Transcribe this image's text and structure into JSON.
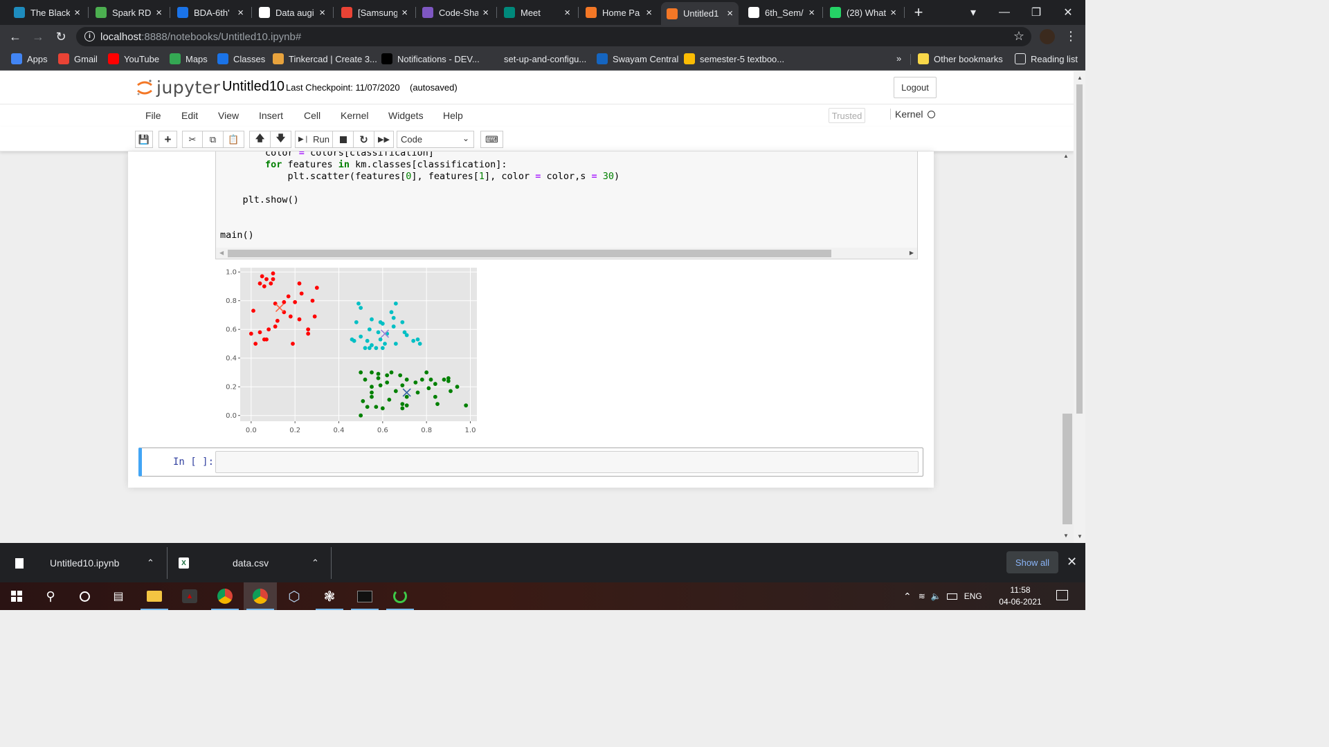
{
  "browser": {
    "tabs": [
      {
        "title": "The Black",
        "icon": "wordpress-icon",
        "color": "#1e8cbe"
      },
      {
        "title": "Spark RDI",
        "icon": "chart-icon",
        "color": "#4caf50"
      },
      {
        "title": "BDA-6th'",
        "icon": "classroom-icon",
        "color": "#1a73e8"
      },
      {
        "title": "Data augi",
        "icon": "github-icon",
        "color": "#ffffff"
      },
      {
        "title": "[Samsung",
        "icon": "gmail-icon",
        "color": "#ea4335"
      },
      {
        "title": "Code-Sha",
        "icon": "list-icon",
        "color": "#7e57c2"
      },
      {
        "title": "Meet",
        "icon": "meet-icon",
        "color": "#00897b"
      },
      {
        "title": "Home Pa",
        "icon": "jupyter-icon",
        "color": "#f37726"
      },
      {
        "title": "Untitled1",
        "icon": "jupyter-book-icon",
        "color": "#f37726",
        "active": true
      },
      {
        "title": "6th_Sem/",
        "icon": "github-icon",
        "color": "#ffffff"
      },
      {
        "title": "(28) What",
        "icon": "whatsapp-icon",
        "color": "#25d366",
        "badge": "28"
      }
    ],
    "new_tab": "+",
    "url_host": "localhost",
    "url_path": ":8888/notebooks/Untitled10.ipynb#",
    "bookmarks": [
      {
        "label": "Apps",
        "icon": "apps-grid-icon"
      },
      {
        "label": "Gmail",
        "icon": "gmail-icon"
      },
      {
        "label": "YouTube",
        "icon": "youtube-icon"
      },
      {
        "label": "Maps",
        "icon": "maps-icon"
      },
      {
        "label": "Classes",
        "icon": "classroom-icon"
      },
      {
        "label": "Tinkercad | Create 3...",
        "icon": "tinkercad-icon"
      },
      {
        "label": "Notifications - DEV...",
        "icon": "dev-icon"
      },
      {
        "label": "set-up-and-configu...",
        "icon": "github-icon"
      },
      {
        "label": "Swayam Central",
        "icon": "swayam-icon"
      },
      {
        "label": "semester-5 textboo...",
        "icon": "drive-icon"
      }
    ],
    "more_bookmarks": "»",
    "other_bookmarks": "Other bookmarks",
    "reading_list": "Reading list"
  },
  "jupyter": {
    "logo_text": "jupyter",
    "notebook_name": "Untitled10",
    "checkpoint": "Last Checkpoint: 11/07/2020",
    "autosave": "(autosaved)",
    "logout": "Logout",
    "menu": [
      "File",
      "Edit",
      "View",
      "Insert",
      "Cell",
      "Kernel",
      "Widgets",
      "Help"
    ],
    "trusted": "Trusted",
    "kernel": "Kernel",
    "run_label": "Run",
    "cell_type": "Code"
  },
  "code": {
    "lines": [
      "        color = colors[classification]",
      "        for features in km.classes[classification]:",
      "            plt.scatter(features[0], features[1], color = color,s = 30)",
      "",
      "    plt.show()",
      "",
      "main()"
    ]
  },
  "input_prompt": "In [ ]:",
  "chart_data": {
    "type": "scatter",
    "title": "",
    "xlabel": "",
    "ylabel": "",
    "xlim": [
      -0.05,
      1.03
    ],
    "ylim": [
      -0.04,
      1.03
    ],
    "x_ticks": [
      "0.0",
      "0.2",
      "0.4",
      "0.6",
      "0.8",
      "1.0"
    ],
    "y_ticks": [
      "0.0",
      "0.2",
      "0.4",
      "0.6",
      "0.8",
      "1.0"
    ],
    "grid": true,
    "series": [
      {
        "color": "#ff0000",
        "points": [
          [
            0.05,
            0.97
          ],
          [
            0.07,
            0.95
          ],
          [
            0.09,
            0.92
          ],
          [
            0.1,
            0.95
          ],
          [
            0.1,
            0.99
          ],
          [
            0.04,
            0.92
          ],
          [
            0.06,
            0.9
          ],
          [
            0.17,
            0.83
          ],
          [
            0.22,
            0.92
          ],
          [
            0.3,
            0.89
          ],
          [
            0.23,
            0.85
          ],
          [
            0.28,
            0.8
          ],
          [
            0.2,
            0.79
          ],
          [
            0.15,
            0.79
          ],
          [
            0.11,
            0.78
          ],
          [
            0.01,
            0.73
          ],
          [
            0.15,
            0.72
          ],
          [
            0.12,
            0.66
          ],
          [
            0.29,
            0.69
          ],
          [
            0.22,
            0.67
          ],
          [
            0.18,
            0.69
          ],
          [
            0.26,
            0.6
          ],
          [
            0.26,
            0.57
          ],
          [
            0.08,
            0.6
          ],
          [
            0.11,
            0.62
          ],
          [
            0.0,
            0.57
          ],
          [
            0.04,
            0.58
          ],
          [
            0.06,
            0.53
          ],
          [
            0.07,
            0.53
          ],
          [
            0.02,
            0.5
          ],
          [
            0.19,
            0.5
          ]
        ]
      },
      {
        "color": "#00bfc4",
        "points": [
          [
            0.49,
            0.78
          ],
          [
            0.5,
            0.75
          ],
          [
            0.66,
            0.78
          ],
          [
            0.64,
            0.72
          ],
          [
            0.55,
            0.67
          ],
          [
            0.59,
            0.65
          ],
          [
            0.65,
            0.68
          ],
          [
            0.69,
            0.65
          ],
          [
            0.48,
            0.65
          ],
          [
            0.6,
            0.64
          ],
          [
            0.65,
            0.62
          ],
          [
            0.54,
            0.6
          ],
          [
            0.58,
            0.58
          ],
          [
            0.7,
            0.58
          ],
          [
            0.71,
            0.56
          ],
          [
            0.62,
            0.57
          ],
          [
            0.5,
            0.55
          ],
          [
            0.59,
            0.53
          ],
          [
            0.46,
            0.53
          ],
          [
            0.53,
            0.52
          ],
          [
            0.47,
            0.52
          ],
          [
            0.61,
            0.5
          ],
          [
            0.66,
            0.5
          ],
          [
            0.74,
            0.52
          ],
          [
            0.76,
            0.53
          ],
          [
            0.77,
            0.5
          ],
          [
            0.55,
            0.49
          ],
          [
            0.54,
            0.47
          ],
          [
            0.57,
            0.47
          ],
          [
            0.6,
            0.47
          ],
          [
            0.52,
            0.47
          ]
        ]
      },
      {
        "color": "#008000",
        "points": [
          [
            0.5,
            0.3
          ],
          [
            0.55,
            0.3
          ],
          [
            0.58,
            0.29
          ],
          [
            0.62,
            0.28
          ],
          [
            0.64,
            0.3
          ],
          [
            0.68,
            0.28
          ],
          [
            0.8,
            0.3
          ],
          [
            0.52,
            0.25
          ],
          [
            0.58,
            0.26
          ],
          [
            0.62,
            0.23
          ],
          [
            0.71,
            0.25
          ],
          [
            0.75,
            0.23
          ],
          [
            0.78,
            0.25
          ],
          [
            0.82,
            0.25
          ],
          [
            0.88,
            0.25
          ],
          [
            0.9,
            0.24
          ],
          [
            0.9,
            0.26
          ],
          [
            0.84,
            0.22
          ],
          [
            0.81,
            0.19
          ],
          [
            0.55,
            0.2
          ],
          [
            0.59,
            0.21
          ],
          [
            0.69,
            0.21
          ],
          [
            0.91,
            0.17
          ],
          [
            0.94,
            0.2
          ],
          [
            0.66,
            0.17
          ],
          [
            0.84,
            0.13
          ],
          [
            0.55,
            0.16
          ],
          [
            0.51,
            0.1
          ],
          [
            0.55,
            0.13
          ],
          [
            0.63,
            0.11
          ],
          [
            0.76,
            0.16
          ],
          [
            0.71,
            0.13
          ],
          [
            0.69,
            0.08
          ],
          [
            0.6,
            0.05
          ],
          [
            0.57,
            0.06
          ],
          [
            0.98,
            0.07
          ],
          [
            0.85,
            0.08
          ],
          [
            0.71,
            0.07
          ],
          [
            0.69,
            0.05
          ],
          [
            0.53,
            0.06
          ],
          [
            0.5,
            0.0
          ]
        ]
      }
    ],
    "centroids": [
      {
        "x": 0.13,
        "y": 0.75,
        "color": "#ff6040",
        "marker": "x"
      },
      {
        "x": 0.61,
        "y": 0.57,
        "color": "#9a82d8",
        "marker": "x"
      },
      {
        "x": 0.71,
        "y": 0.16,
        "color": "#3060a0",
        "marker": "x"
      }
    ]
  },
  "downloads": [
    {
      "name": "Untitled10.ipynb",
      "icon": "file-icon"
    },
    {
      "name": "data.csv",
      "icon": "excel-icon"
    }
  ],
  "show_all": "Show all",
  "tray": {
    "lang": "ENG",
    "time": "11:58",
    "date": "04-06-2021"
  }
}
